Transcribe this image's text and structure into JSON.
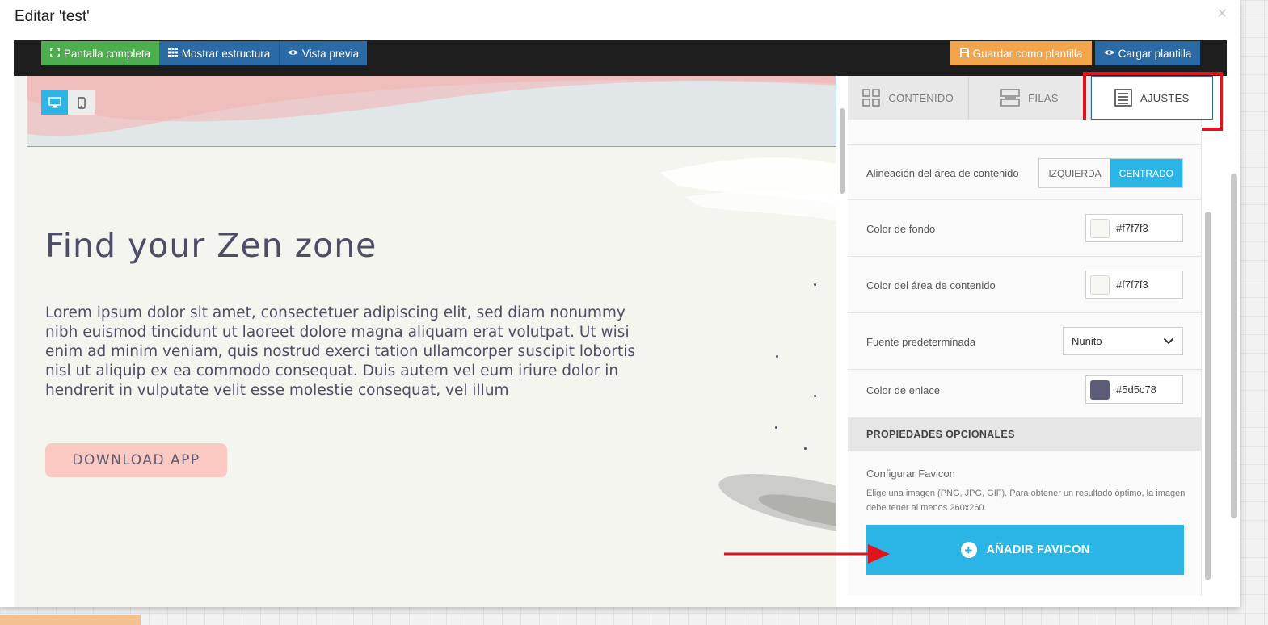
{
  "window": {
    "title": "Editar 'test'",
    "close_symbol": "×"
  },
  "toolbar": {
    "fullscreen": "Pantalla completa",
    "structure": "Mostrar estructura",
    "preview": "Vista previa",
    "save_template": "Guardar como plantilla",
    "load_template": "Cargar plantilla"
  },
  "device_toggle": {
    "desktop": "desktop-icon",
    "mobile": "mobile-icon",
    "active": "desktop"
  },
  "canvas": {
    "title": "Find your Zen zone",
    "body": "Lorem ipsum dolor sit amet, consectetuer adipiscing elit, sed diam nonummy nibh euismod tincidunt ut laoreet dolore magna aliquam erat volutpat. Ut wisi enim ad minim veniam, quis nostrud exerci tation ullamcorper suscipit lobortis nisl ut aliquip ex ea commodo consequat. Duis autem vel eum iriure dolor in hendrerit in vulputate velit esse molestie consequat, vel illum",
    "button": "DOWNLOAD APP"
  },
  "tabs": [
    {
      "label": "CONTENIDO",
      "icon": "grid-icon"
    },
    {
      "label": "FILAS",
      "icon": "rows-icon"
    },
    {
      "label": "AJUSTES",
      "icon": "settings-doc-icon",
      "active": true
    }
  ],
  "settings": {
    "alignment": {
      "label": "Alineación del área de contenido",
      "left": "IZQUIERDA",
      "center": "CENTRADO",
      "selected": "CENTRADO"
    },
    "bg_color": {
      "label": "Color de fondo",
      "value": "#f7f7f3"
    },
    "content_color": {
      "label": "Color del área de contenido",
      "value": "#f7f7f3"
    },
    "default_font": {
      "label": "Fuente predeterminada",
      "value": "Nunito"
    },
    "link_color": {
      "label": "Color de enlace",
      "value": "#5d5c78"
    },
    "optional_header": "PROPIEDADES OPCIONALES",
    "favicon": {
      "title": "Configurar Favicon",
      "description": "Elige una imagen (PNG, JPG, GIF). Para obtener un resultado óptimo, la imagen debe tener al menos 260x260.",
      "button": "AÑADIR FAVICON"
    }
  },
  "colors": {
    "accent": "#2bb4e6",
    "toolbar_green": "#4cae4c",
    "toolbar_blue": "#2a6aa6",
    "toolbar_orange": "#f2a54a",
    "highlight_red": "#e1141e",
    "button_pink": "#fbc8c2",
    "text_dark": "#4d4d66"
  }
}
